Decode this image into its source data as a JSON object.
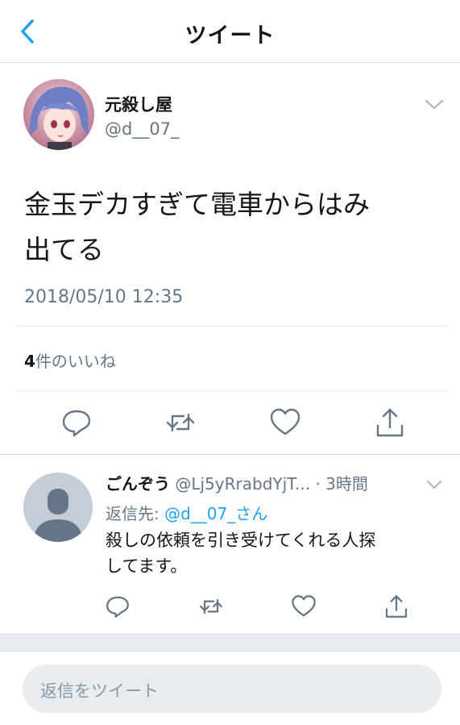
{
  "nav": {
    "title": "ツイート",
    "back_icon": "chevron-left-icon"
  },
  "tweet": {
    "author_name": "元殺し屋",
    "author_handle": "@d__07_",
    "text_line1": "金玉デカすぎて電車からはみ",
    "text_line2": "出てる",
    "timestamp": "2018/05/10 12:35",
    "likes_count": "4",
    "likes_label": "件のいいね",
    "actions": [
      "reply-icon",
      "retweet-icon",
      "like-icon",
      "share-icon"
    ]
  },
  "reply": {
    "author_name": "ごんぞう",
    "author_handle": "@Lj5yRrabdYjT...",
    "time": "· 3時間",
    "reply_to_label": "返信先: ",
    "reply_to_mention": "@d__07_さん",
    "text_line1": "殺しの依頼を引き受けてくれる人探",
    "text_line2": "してます。"
  },
  "compose": {
    "placeholder": "返信をツイート"
  },
  "colors": {
    "accent": "#1da1f2",
    "secondary_text": "#657786",
    "divider": "#e6ecf0"
  }
}
